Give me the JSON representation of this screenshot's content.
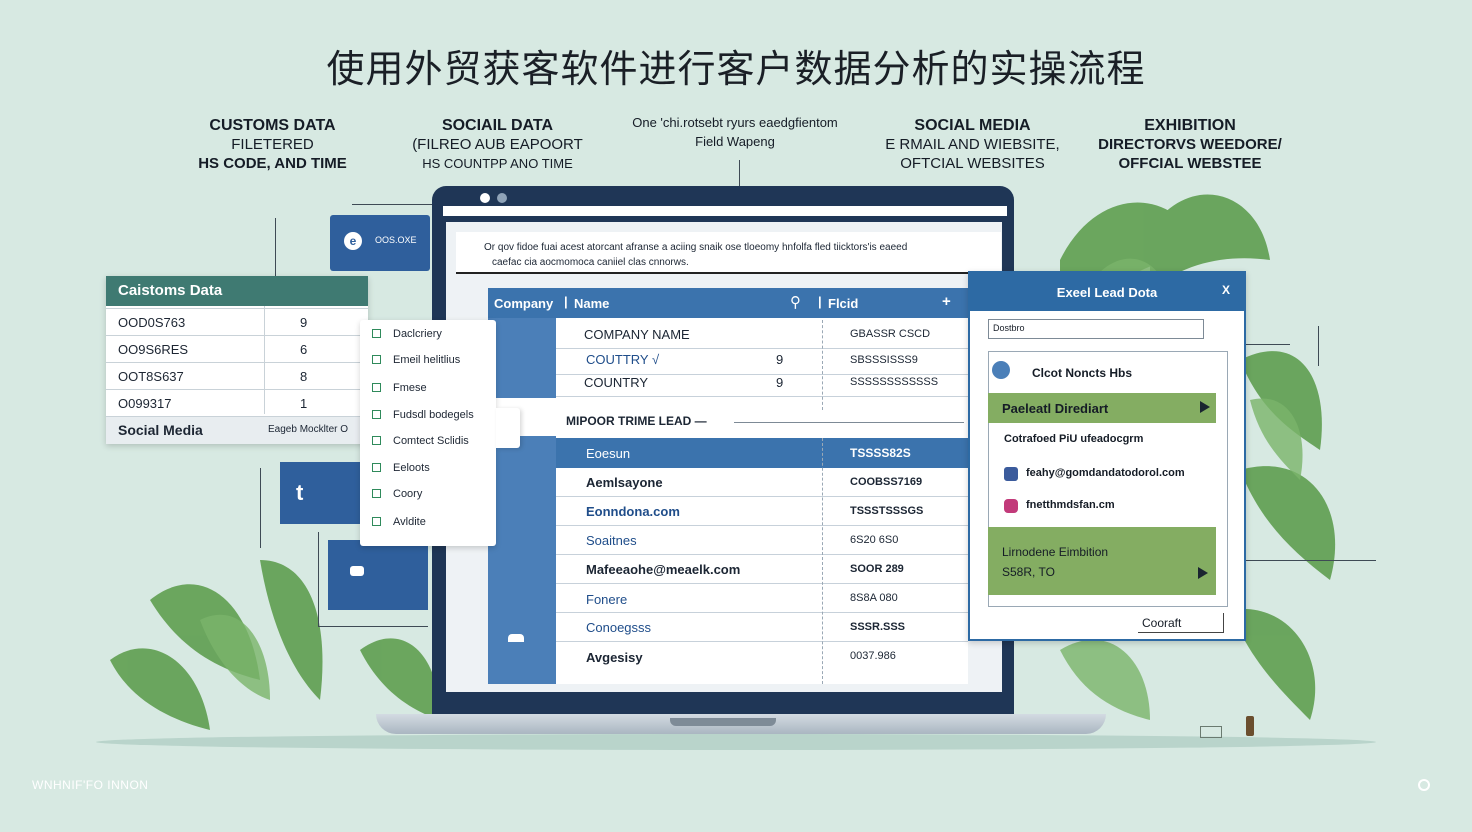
{
  "title": "使用外贸获客软件进行客户数据分析的实操流程",
  "headers": {
    "customs": [
      "CUSTOMS DATA",
      "FILETERED",
      "HS CODE, AND TIME"
    ],
    "social": [
      "SOCIAIL DATA",
      "(FILREO AUB EAPOORT",
      "HS COUNTPP ANO TIME"
    ],
    "field": [
      "One 'chi.rotsebt ryurs eaedgfientom",
      "Field Wapeng"
    ],
    "social_media": [
      "SOCIAL MEDIA",
      "E RMAIL AND WIEBSITE,",
      "OFTCIAL WEBSITES"
    ],
    "exhibition": [
      "EXHIBITION",
      "DIRECTORVS WEEDORE/",
      "OFFCIAL WEBSTEE"
    ]
  },
  "customs_panel": {
    "title": "Caistoms Data",
    "rows": [
      {
        "code": "OOD0S763",
        "val": "9"
      },
      {
        "code": "OO9S6RES",
        "val": "6"
      },
      {
        "code": "OOT8S637",
        "val": "8"
      },
      {
        "code": "O099317",
        "val": "1"
      }
    ],
    "social_label": "Social Media",
    "social_value": "Eageb Mocklter O"
  },
  "small_badge": "OOS.OXE",
  "checklist": [
    "Daclcriery",
    "Emeil helitlius",
    "Fmese",
    "Fudsdl bodegels",
    "Comtect Sclidis",
    "Eeloots",
    "Coory",
    "Avldite"
  ],
  "laptop": {
    "note_line1": "Or qov fidoe fuai acest atorcant afranse a aciing snaik ose tloeomy hnfolfa fled tiicktors'is eaeed",
    "note_line2": "caefac cia aocmomoca caniiel clas cnnorws.",
    "table_header": {
      "company": "Company",
      "name": "Name",
      "field": "Flcid",
      "plus": "+"
    },
    "top_rows": [
      {
        "label": "COMPANY NAME",
        "num": "",
        "right": "GBASSR CSCD"
      },
      {
        "label": "COUTTRY √",
        "num": "9",
        "right": "SBSSSISSS9"
      },
      {
        "label": "COUNTRY",
        "num": "9",
        "right": "SSSSSSSSSSSS"
      }
    ],
    "import_label": "MIPOOR TRIME LEAD —",
    "blue_row": {
      "label": "Eoesun",
      "right": "TSSSS82S"
    },
    "rows": [
      {
        "label": "Aemlsayone",
        "right": "COOBSS7169"
      },
      {
        "label": "Eonndona.com",
        "right": "TSSSTSSSGS"
      },
      {
        "label": "Soaitnes",
        "right": "6S20 6S0"
      },
      {
        "label": "Mafeeaohe@meaelk.com",
        "right": "SOOR 289"
      },
      {
        "label": "Fonere",
        "right": "8S8A 080"
      },
      {
        "label": "Conoegsss",
        "right": "SSSR.SSS"
      },
      {
        "label": "Avgesisy",
        "right": "0037.986"
      }
    ]
  },
  "excel": {
    "title": "Exeel Lead Dota",
    "close": "X",
    "search_value": "Dostbro",
    "item_top": "Clcot Noncts Hbs",
    "green_row": "Paeleatl Dirediart",
    "contact": "Cotrafoed PiU ufeadocgrm",
    "facebook": "feahy@gomdandatodorol.com",
    "instagram": "fnetthmdsfan.cm",
    "exhibition_line1": "Lirnodene Eimbition",
    "exhibition_line2": "S58R, TO",
    "contact_button": "Cooraft"
  },
  "footer_left": "WNHNIF'FO INNON",
  "colors": {
    "background": "#d7e9e2",
    "teal_header": "#3f7a72",
    "navy": "#1f3656",
    "blue": "#3b73ad",
    "green": "#84ad62",
    "leaf": "#5a9a4a"
  }
}
